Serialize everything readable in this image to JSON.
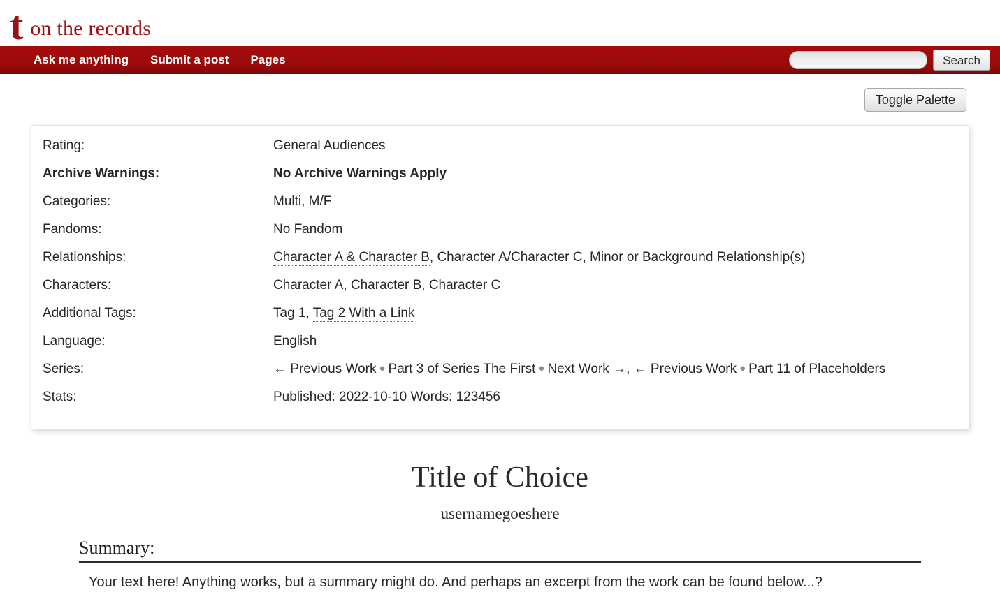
{
  "header": {
    "logo_glyph": "t",
    "site_title": "on the records"
  },
  "nav": {
    "links": [
      {
        "label": "Ask me anything"
      },
      {
        "label": "Submit a post"
      },
      {
        "label": "Pages"
      }
    ],
    "search": {
      "value": "",
      "placeholder": "",
      "button_label": "Search"
    }
  },
  "toolbar": {
    "toggle_palette_label": "Toggle Palette"
  },
  "meta": {
    "rows": [
      {
        "label": "Rating:",
        "value": "General Audiences"
      },
      {
        "label": "Archive Warnings:",
        "value": "No Archive Warnings Apply"
      },
      {
        "label": "Categories:",
        "value": "Multi, M/F"
      },
      {
        "label": "Fandoms:",
        "value": "No Fandom"
      },
      {
        "label": "Relationships:"
      },
      {
        "label": "Characters:",
        "value": "Character A, Character B, Character C"
      },
      {
        "label": "Additional Tags:"
      },
      {
        "label": "Language:",
        "value": "English"
      },
      {
        "label": "Series:"
      },
      {
        "label": "Stats:",
        "value": "Published: 2022-10-10   Words: 123456"
      }
    ],
    "relationships": {
      "link": "Character A & Character B",
      "rest": ", Character A/Character C, Minor or Background Relationship(s)"
    },
    "additional_tags": {
      "plain": "Tag 1, ",
      "link": "Tag 2 With a Link"
    },
    "series": {
      "prev_1": "← Previous Work",
      "bullet_1": "●",
      "part_1": "Part 3 of",
      "series_1": "Series The First",
      "bullet_2": "●",
      "next_1": "Next Work →",
      "comma": ",",
      "prev_2": "← Previous Work",
      "bullet_3": "●",
      "part_2": "Part 11 of",
      "series_2": "Placeholders"
    }
  },
  "work": {
    "title": "Title of Choice",
    "byline": "usernamegoeshere",
    "summary_heading": "Summary:",
    "summary_text": "Your text here! Anything works, but a summary might do. And perhaps an excerpt from the work can be found below...?"
  },
  "colors": {
    "brand_red": "#9c1111",
    "nav_red": "#a00b0b",
    "text": "#272727"
  }
}
